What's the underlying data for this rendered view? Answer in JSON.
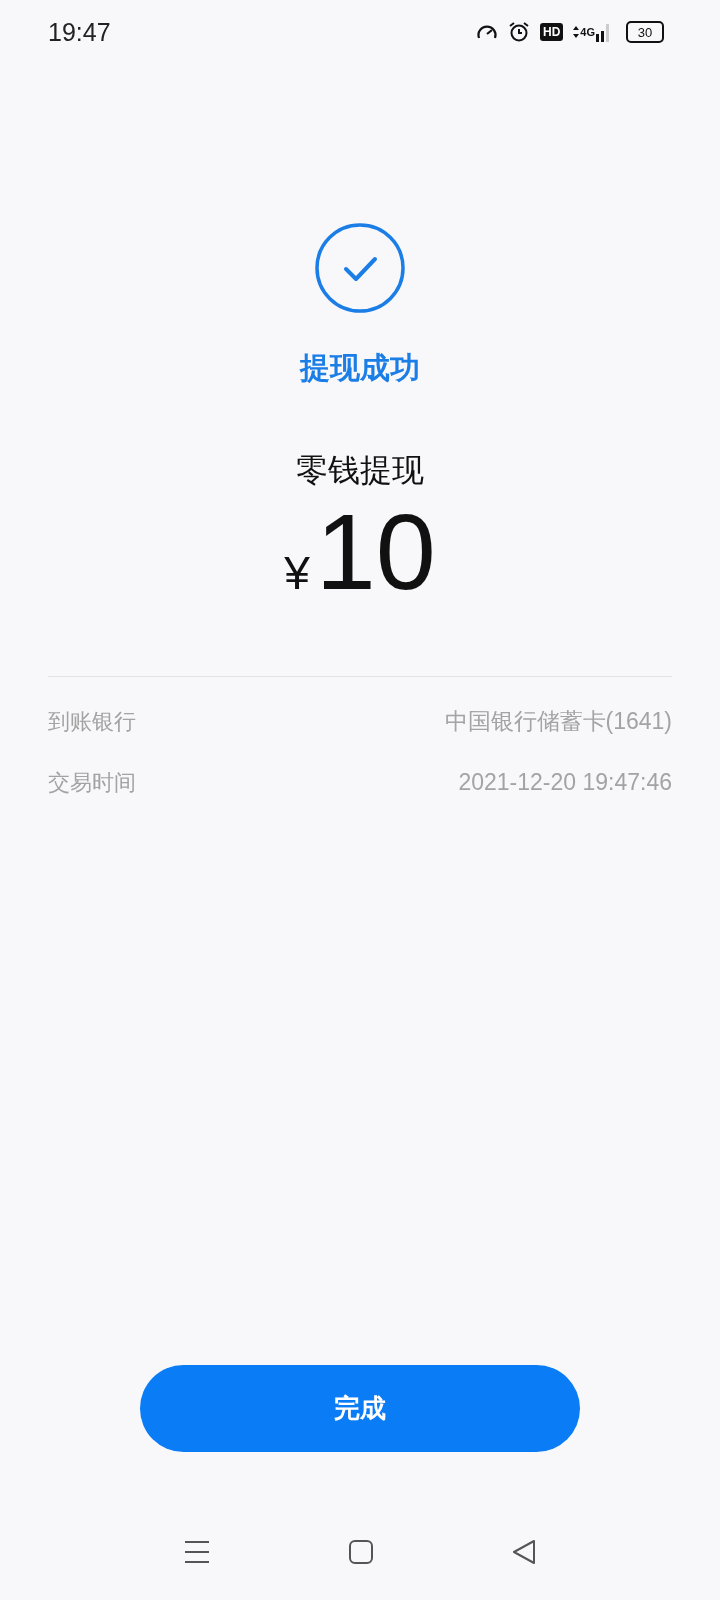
{
  "status_bar": {
    "time": "19:47",
    "hd": "HD",
    "network": "4G",
    "battery": "30"
  },
  "result": {
    "title": "提现成功",
    "kind": "success"
  },
  "transaction": {
    "type": "零钱提现",
    "currency": "¥",
    "amount": "10"
  },
  "details": [
    {
      "label": "到账银行",
      "value": "中国银行储蓄卡(1641)"
    },
    {
      "label": "交易时间",
      "value": "2021-12-20 19:47:46"
    }
  ],
  "done_button": "完成"
}
